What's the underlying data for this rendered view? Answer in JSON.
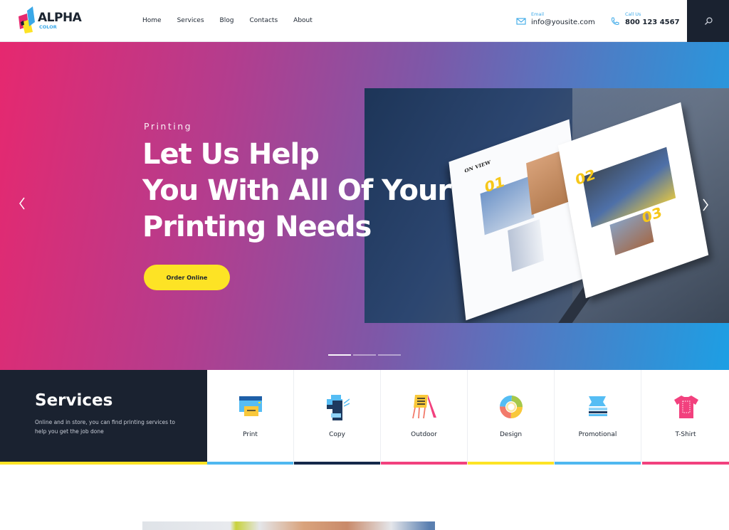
{
  "header": {
    "logo": {
      "name": "ALPHA",
      "sub": "COLOR"
    },
    "nav": [
      {
        "label": "Home"
      },
      {
        "label": "Services"
      },
      {
        "label": "Blog"
      },
      {
        "label": "Contacts"
      },
      {
        "label": "About"
      }
    ],
    "email": {
      "label": "Email",
      "value": "info@yousite.com",
      "icon": "envelope-icon"
    },
    "phone": {
      "label": "Call Us",
      "value": "800 123 4567",
      "icon": "phone-icon"
    },
    "search": {
      "icon": "search-icon"
    }
  },
  "hero": {
    "kicker": "Printing",
    "headline_lines": [
      "Let Us Help",
      "You With All Of Your",
      "Printing Needs"
    ],
    "cta": "Order Online",
    "prev_icon": "chevron-left-icon",
    "next_icon": "chevron-right-icon",
    "slides_total": 3,
    "active_slide": 1,
    "image": {
      "page_heading": "ON VIEW",
      "numbers": [
        "01",
        "02",
        "03"
      ]
    }
  },
  "services": {
    "title": "Services",
    "description": "Online and in store, you can find printing services to help you get the job done",
    "items": [
      {
        "label": "Print",
        "icon": "printer-icon",
        "accent": "#4fb8f0"
      },
      {
        "label": "Copy",
        "icon": "copier-icon",
        "accent": "#15294a"
      },
      {
        "label": "Outdoor",
        "icon": "sandwich-board-icon",
        "accent": "#f2417e"
      },
      {
        "label": "Design",
        "icon": "color-wheel-icon",
        "accent": "#fde325"
      },
      {
        "label": "Promotional",
        "icon": "paper-stack-icon",
        "accent": "#4fb8f0"
      },
      {
        "label": "T-Shirt",
        "icon": "tshirt-icon",
        "accent": "#f2417e"
      }
    ]
  },
  "colors": {
    "dark": "#1a2230",
    "yellow": "#fde325",
    "blue": "#3aa8e8",
    "pink": "#e6286f"
  }
}
